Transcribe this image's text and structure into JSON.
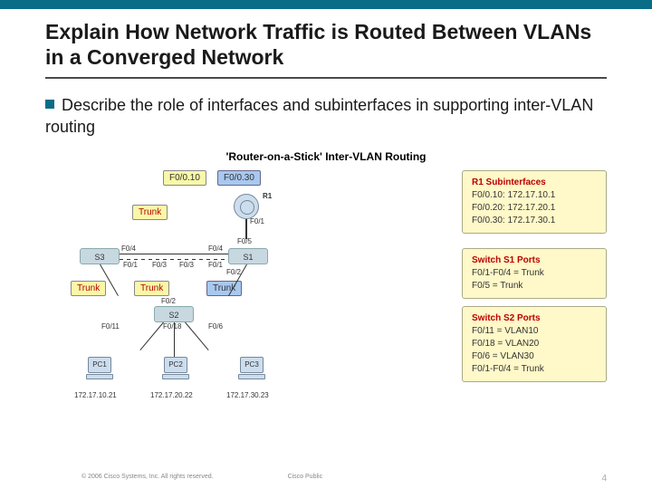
{
  "title": "Explain How Network Traffic is Routed Between VLANs in a Converged Network",
  "bullet": "Describe the role of interfaces and subinterfaces in supporting inter-VLAN routing",
  "figtitle": "'Router-on-a-Stick' Inter-VLAN Routing",
  "labels": {
    "f0010": "F0/0.10",
    "f0030": "F0/0.30",
    "r1": "R1",
    "f01": "F0/1",
    "trunk": "Trunk",
    "s3": "S3",
    "s1": "S1",
    "s2": "S2",
    "f04": "F0/4",
    "f05": "F0/5",
    "f06": "F0/6",
    "f0_1": "F0/1",
    "f0_2": "F0/2",
    "f0_3": "F0/3",
    "f011": "F0/11",
    "f018": "F0/18",
    "f06b": "F0/6",
    "pc1": "PC1",
    "pc2": "PC2",
    "pc3": "PC3",
    "ip1": "172.17.10.21",
    "ip2": "172.17.20.22",
    "ip3": "172.17.30.23"
  },
  "panel1": {
    "title": "R1 Subinterfaces",
    "l1": "F0/0.10: 172.17.10.1",
    "l2": "F0/0.20: 172.17.20.1",
    "l3": "F0/0.30: 172.17.30.1"
  },
  "panel2": {
    "title": "Switch S1 Ports",
    "l1": "F0/1-F0/4 = Trunk",
    "l2": "F0/5 = Trunk"
  },
  "panel3": {
    "title": "Switch S2 Ports",
    "l1": "F0/11 = VLAN10",
    "l2": "F0/18 = VLAN20",
    "l3": "F0/6 = VLAN30",
    "l4": "F0/1-F0/4 = Trunk"
  },
  "footer": {
    "copy": "© 2006 Cisco Systems, Inc. All rights reserved.",
    "pub": "Cisco Public",
    "num": "4"
  }
}
